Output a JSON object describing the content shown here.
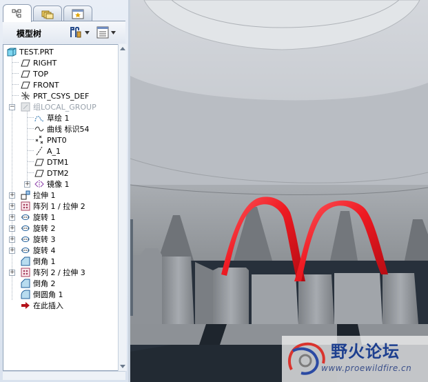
{
  "panel": {
    "title": "模型树",
    "tabs": [
      {
        "icon": "model-tree-icon"
      },
      {
        "icon": "folder-browser-icon"
      },
      {
        "icon": "favorites-icon"
      }
    ],
    "settings_icon": "tree-settings-icon",
    "columns_icon": "tree-columns-icon"
  },
  "tree": [
    {
      "label": "TEST.PRT",
      "icon": "part-icon"
    },
    {
      "label": "RIGHT",
      "icon": "datum-plane-icon"
    },
    {
      "label": "TOP",
      "icon": "datum-plane-icon"
    },
    {
      "label": "FRONT",
      "icon": "datum-plane-icon"
    },
    {
      "label": "PRT_CSYS_DEF",
      "icon": "csys-icon"
    },
    {
      "label": "组LOCAL_GROUP",
      "icon": "group-icon"
    },
    {
      "label": "草绘 1",
      "icon": "sketch-icon"
    },
    {
      "label": "曲线 标识54",
      "icon": "curve-icon"
    },
    {
      "label": "PNT0",
      "icon": "datum-point-icon"
    },
    {
      "label": "A_1",
      "icon": "datum-axis-icon"
    },
    {
      "label": "DTM1",
      "icon": "datum-plane-icon"
    },
    {
      "label": "DTM2",
      "icon": "datum-plane-icon"
    },
    {
      "label": "镜像 1",
      "icon": "mirror-icon"
    },
    {
      "label": "拉伸 1",
      "icon": "extrude-icon"
    },
    {
      "label": "阵列 1 / 拉伸 2",
      "icon": "pattern-icon"
    },
    {
      "label": "旋转 1",
      "icon": "revolve-icon"
    },
    {
      "label": "旋转 2",
      "icon": "revolve-icon"
    },
    {
      "label": "旋转 3",
      "icon": "revolve-icon"
    },
    {
      "label": "旋转 4",
      "icon": "revolve-icon"
    },
    {
      "label": "倒角 1",
      "icon": "chamfer-icon"
    },
    {
      "label": "阵列 2 / 拉伸 3",
      "icon": "pattern-icon"
    },
    {
      "label": "倒角 2",
      "icon": "chamfer-icon"
    },
    {
      "label": "倒圆角 1",
      "icon": "round-icon"
    },
    {
      "label": "在此插入",
      "icon": "insert-here-icon"
    }
  ],
  "colors": {
    "curve_highlight": "#e8121a",
    "model_grey": "#9a9da1",
    "background_dark": "#27303b"
  },
  "watermark": {
    "title": "野火论坛",
    "url": "www.proewildfire.cn"
  }
}
